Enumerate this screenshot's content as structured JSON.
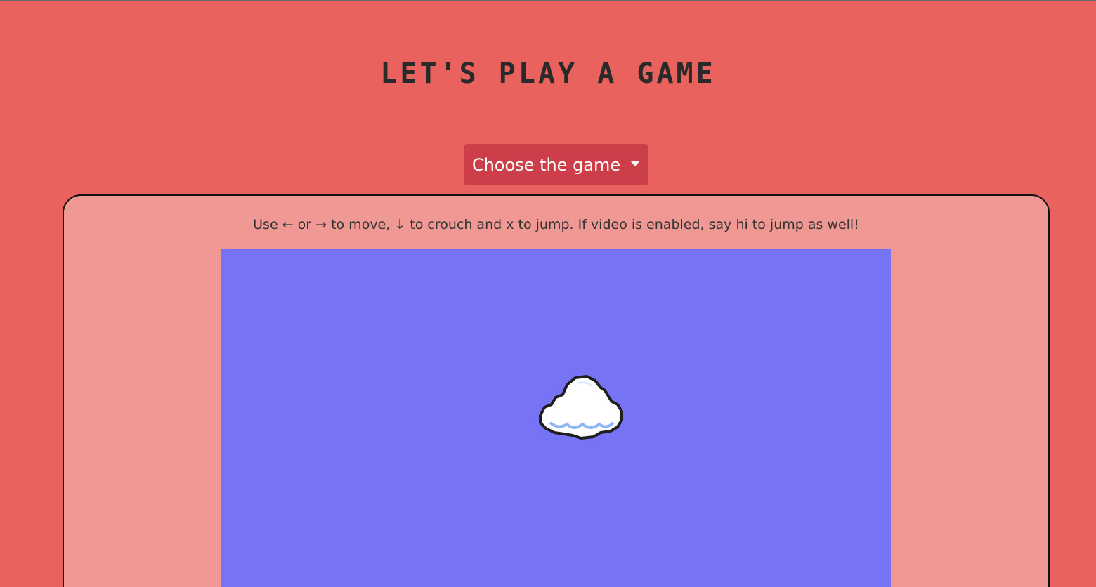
{
  "header": {
    "title": "LET'S PLAY A GAME"
  },
  "dropdown": {
    "label": "Choose the game"
  },
  "game": {
    "instructions": "Use ← or → to move, ↓ to crouch and x to jump. If video is enabled, say hi to jump as well!",
    "sky_color": "#7674f5"
  },
  "colors": {
    "background": "#ea625e",
    "panel": "#f09893",
    "button": "#cc3f4a"
  },
  "icons": [
    "caret-down-icon",
    "cloud-sprite"
  ]
}
